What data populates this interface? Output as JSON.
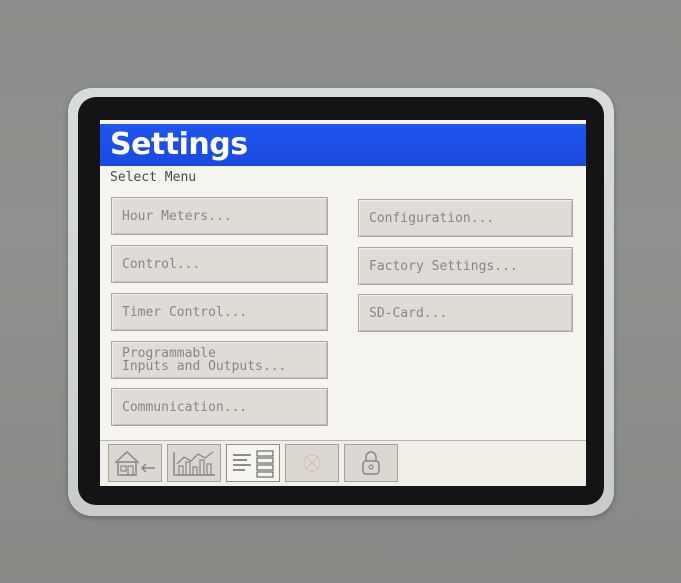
{
  "header": {
    "title": "Settings",
    "subtitle": "Select Menu"
  },
  "menu": {
    "left": [
      {
        "label": "Hour Meters..."
      },
      {
        "label": "Control..."
      },
      {
        "label": "Timer Control..."
      },
      {
        "label_line1": "Programmable",
        "label_line2": "Inputs and Outputs..."
      },
      {
        "label": "Communication..."
      }
    ],
    "right": [
      {
        "label": "Configuration..."
      },
      {
        "label": "Factory Settings..."
      },
      {
        "label": "SD-Card..."
      }
    ]
  },
  "bottom_tabs": [
    {
      "icon": "home-back-icon",
      "active": false
    },
    {
      "icon": "chart-icon",
      "active": false
    },
    {
      "icon": "menu-list-icon",
      "active": true
    },
    {
      "icon": "alarm-icon",
      "active": false
    },
    {
      "icon": "lock-icon",
      "active": false
    }
  ],
  "colors": {
    "title_bar": "#1e56ee",
    "screen_bg": "#f6f4ee",
    "button_bg": "#e1dbd6",
    "button_text": "#8a8683",
    "bezel": "#141416"
  }
}
